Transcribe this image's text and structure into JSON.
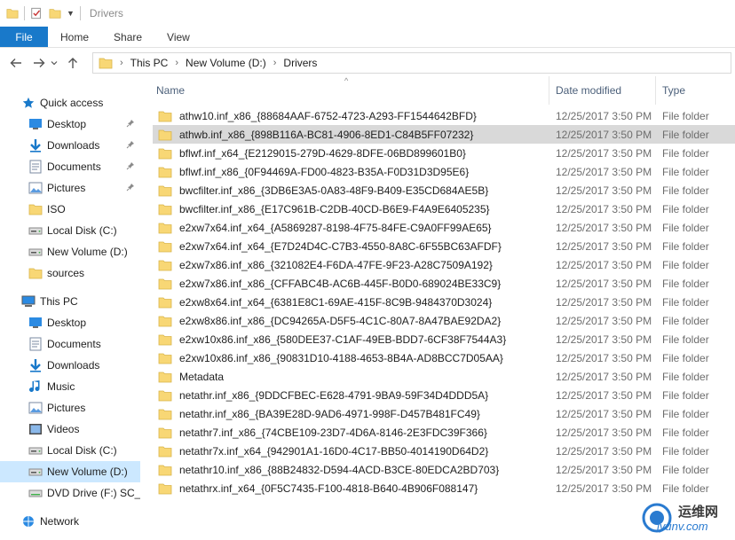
{
  "window": {
    "title": "Drivers"
  },
  "ribbon": {
    "tabs": [
      "File",
      "Home",
      "Share",
      "View"
    ]
  },
  "address": {
    "crumbs": [
      "This PC",
      "New Volume (D:)",
      "Drivers"
    ]
  },
  "columns": {
    "name": "Name",
    "date": "Date modified",
    "type": "Type"
  },
  "nav": {
    "items": [
      {
        "label": "Quick access",
        "icon": "star-icon"
      },
      {
        "label": "Desktop",
        "icon": "desktop-icon",
        "pinned": true
      },
      {
        "label": "Downloads",
        "icon": "download-icon",
        "pinned": true
      },
      {
        "label": "Documents",
        "icon": "documents-icon",
        "pinned": true
      },
      {
        "label": "Pictures",
        "icon": "pictures-icon",
        "pinned": true
      },
      {
        "label": "ISO",
        "icon": "folder-icon"
      },
      {
        "label": "Local Disk (C:)",
        "icon": "drive-icon"
      },
      {
        "label": "New Volume (D:)",
        "icon": "drive-icon"
      },
      {
        "label": "sources",
        "icon": "folder-icon"
      },
      {
        "label": "This PC",
        "icon": "computer-icon"
      },
      {
        "label": "Desktop",
        "icon": "desktop-icon"
      },
      {
        "label": "Documents",
        "icon": "documents-icon"
      },
      {
        "label": "Downloads",
        "icon": "download-icon"
      },
      {
        "label": "Music",
        "icon": "music-icon"
      },
      {
        "label": "Pictures",
        "icon": "pictures-icon"
      },
      {
        "label": "Videos",
        "icon": "videos-icon"
      },
      {
        "label": "Local Disk (C:)",
        "icon": "drive-icon"
      },
      {
        "label": "New Volume (D:)",
        "icon": "drive-icon",
        "selected": true
      },
      {
        "label": "DVD Drive (F:) SC_C",
        "icon": "dvd-icon"
      },
      {
        "label": "Network",
        "icon": "network-icon"
      }
    ]
  },
  "files": [
    {
      "name": "athw10.inf_x86_{88684AAF-6752-4723-A293-FF1544642BFD}",
      "date": "12/25/2017 3:50 PM",
      "type": "File folder"
    },
    {
      "name": "athwb.inf_x86_{898B116A-BC81-4906-8ED1-C84B5FF07232}",
      "date": "12/25/2017 3:50 PM",
      "type": "File folder",
      "selected": true
    },
    {
      "name": "bflwf.inf_x64_{E2129015-279D-4629-8DFE-06BD899601B0}",
      "date": "12/25/2017 3:50 PM",
      "type": "File folder"
    },
    {
      "name": "bflwf.inf_x86_{0F94469A-FD00-4823-B35A-F0D31D3D95E6}",
      "date": "12/25/2017 3:50 PM",
      "type": "File folder"
    },
    {
      "name": "bwcfilter.inf_x86_{3DB6E3A5-0A83-48F9-B409-E35CD684AE5B}",
      "date": "12/25/2017 3:50 PM",
      "type": "File folder"
    },
    {
      "name": "bwcfilter.inf_x86_{E17C961B-C2DB-40CD-B6E9-F4A9E6405235}",
      "date": "12/25/2017 3:50 PM",
      "type": "File folder"
    },
    {
      "name": "e2xw7x64.inf_x64_{A5869287-8198-4F75-84FE-C9A0FF99AE65}",
      "date": "12/25/2017 3:50 PM",
      "type": "File folder"
    },
    {
      "name": "e2xw7x64.inf_x64_{E7D24D4C-C7B3-4550-8A8C-6F55BC63AFDF}",
      "date": "12/25/2017 3:50 PM",
      "type": "File folder"
    },
    {
      "name": "e2xw7x86.inf_x86_{321082E4-F6DA-47FE-9F23-A28C7509A192}",
      "date": "12/25/2017 3:50 PM",
      "type": "File folder"
    },
    {
      "name": "e2xw7x86.inf_x86_{CFFABC4B-AC6B-445F-B0D0-689024BE33C9}",
      "date": "12/25/2017 3:50 PM",
      "type": "File folder"
    },
    {
      "name": "e2xw8x64.inf_x64_{6381E8C1-69AE-415F-8C9B-9484370D3024}",
      "date": "12/25/2017 3:50 PM",
      "type": "File folder"
    },
    {
      "name": "e2xw8x86.inf_x86_{DC94265A-D5F5-4C1C-80A7-8A47BAE92DA2}",
      "date": "12/25/2017 3:50 PM",
      "type": "File folder"
    },
    {
      "name": "e2xw10x86.inf_x86_{580DEE37-C1AF-49EB-BDD7-6CF38F7544A3}",
      "date": "12/25/2017 3:50 PM",
      "type": "File folder"
    },
    {
      "name": "e2xw10x86.inf_x86_{90831D10-4188-4653-8B4A-AD8BCC7D05AA}",
      "date": "12/25/2017 3:50 PM",
      "type": "File folder"
    },
    {
      "name": "Metadata",
      "date": "12/25/2017 3:50 PM",
      "type": "File folder"
    },
    {
      "name": "netathr.inf_x86_{9DDCFBEC-E628-4791-9BA9-59F34D4DDD5A}",
      "date": "12/25/2017 3:50 PM",
      "type": "File folder"
    },
    {
      "name": "netathr.inf_x86_{BA39E28D-9AD6-4971-998F-D457B481FC49}",
      "date": "12/25/2017 3:50 PM",
      "type": "File folder"
    },
    {
      "name": "netathr7.inf_x86_{74CBE109-23D7-4D6A-8146-2E3FDC39F366}",
      "date": "12/25/2017 3:50 PM",
      "type": "File folder"
    },
    {
      "name": "netathr7x.inf_x64_{942901A1-16D0-4C17-BB50-4014190D64D2}",
      "date": "12/25/2017 3:50 PM",
      "type": "File folder"
    },
    {
      "name": "netathr10.inf_x86_{88B24832-D594-4ACD-B3CE-80EDCA2BD703}",
      "date": "12/25/2017 3:50 PM",
      "type": "File folder"
    },
    {
      "name": "netathrx.inf_x64_{0F5C7435-F100-4818-B640-4B906F088147}",
      "date": "12/25/2017 3:50 PM",
      "type": "File folder"
    }
  ],
  "watermark": {
    "line1": "运维网",
    "line2": "iyunv.com"
  },
  "colors": {
    "accent": "#1979ca",
    "folder": "#f8d775",
    "selection": "#cce8ff"
  }
}
